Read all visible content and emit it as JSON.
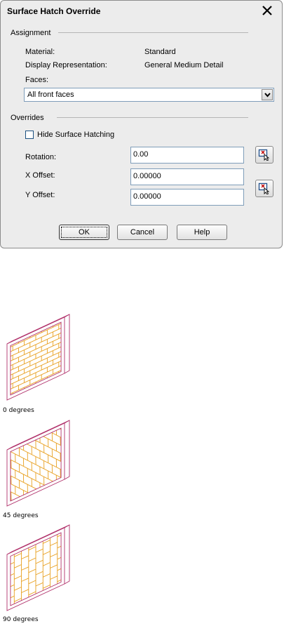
{
  "dialog": {
    "title": "Surface Hatch Override",
    "assignment": {
      "section": "Assignment",
      "material_label": "Material:",
      "material_value": "Standard",
      "display_label": "Display Representation:",
      "display_value": "General Medium Detail",
      "faces_label": "Faces:",
      "faces_value": "All front faces"
    },
    "overrides": {
      "section": "Overrides",
      "hide_label": "Hide Surface Hatching",
      "hide_checked": false,
      "rotation_label": "Rotation:",
      "rotation_value": "0.00",
      "xoffset_label": "X Offset:",
      "xoffset_value": "0.00000",
      "yoffset_label": "Y Offset:",
      "yoffset_value": "0.00000"
    },
    "buttons": {
      "ok": "OK",
      "cancel": "Cancel",
      "help": "Help"
    }
  },
  "illustrations": [
    {
      "caption": "0 degrees",
      "rotation": 0
    },
    {
      "caption": "45 degrees",
      "rotation": 45
    },
    {
      "caption": "90 degrees",
      "rotation": 90
    }
  ],
  "colors": {
    "hatch": "#e8a020",
    "outline": "#b0306a",
    "dialog_bg": "#ececec"
  },
  "icons": {
    "close": "close-icon",
    "pick": "pick-point-icon",
    "dropdown": "chevron-down-icon"
  }
}
